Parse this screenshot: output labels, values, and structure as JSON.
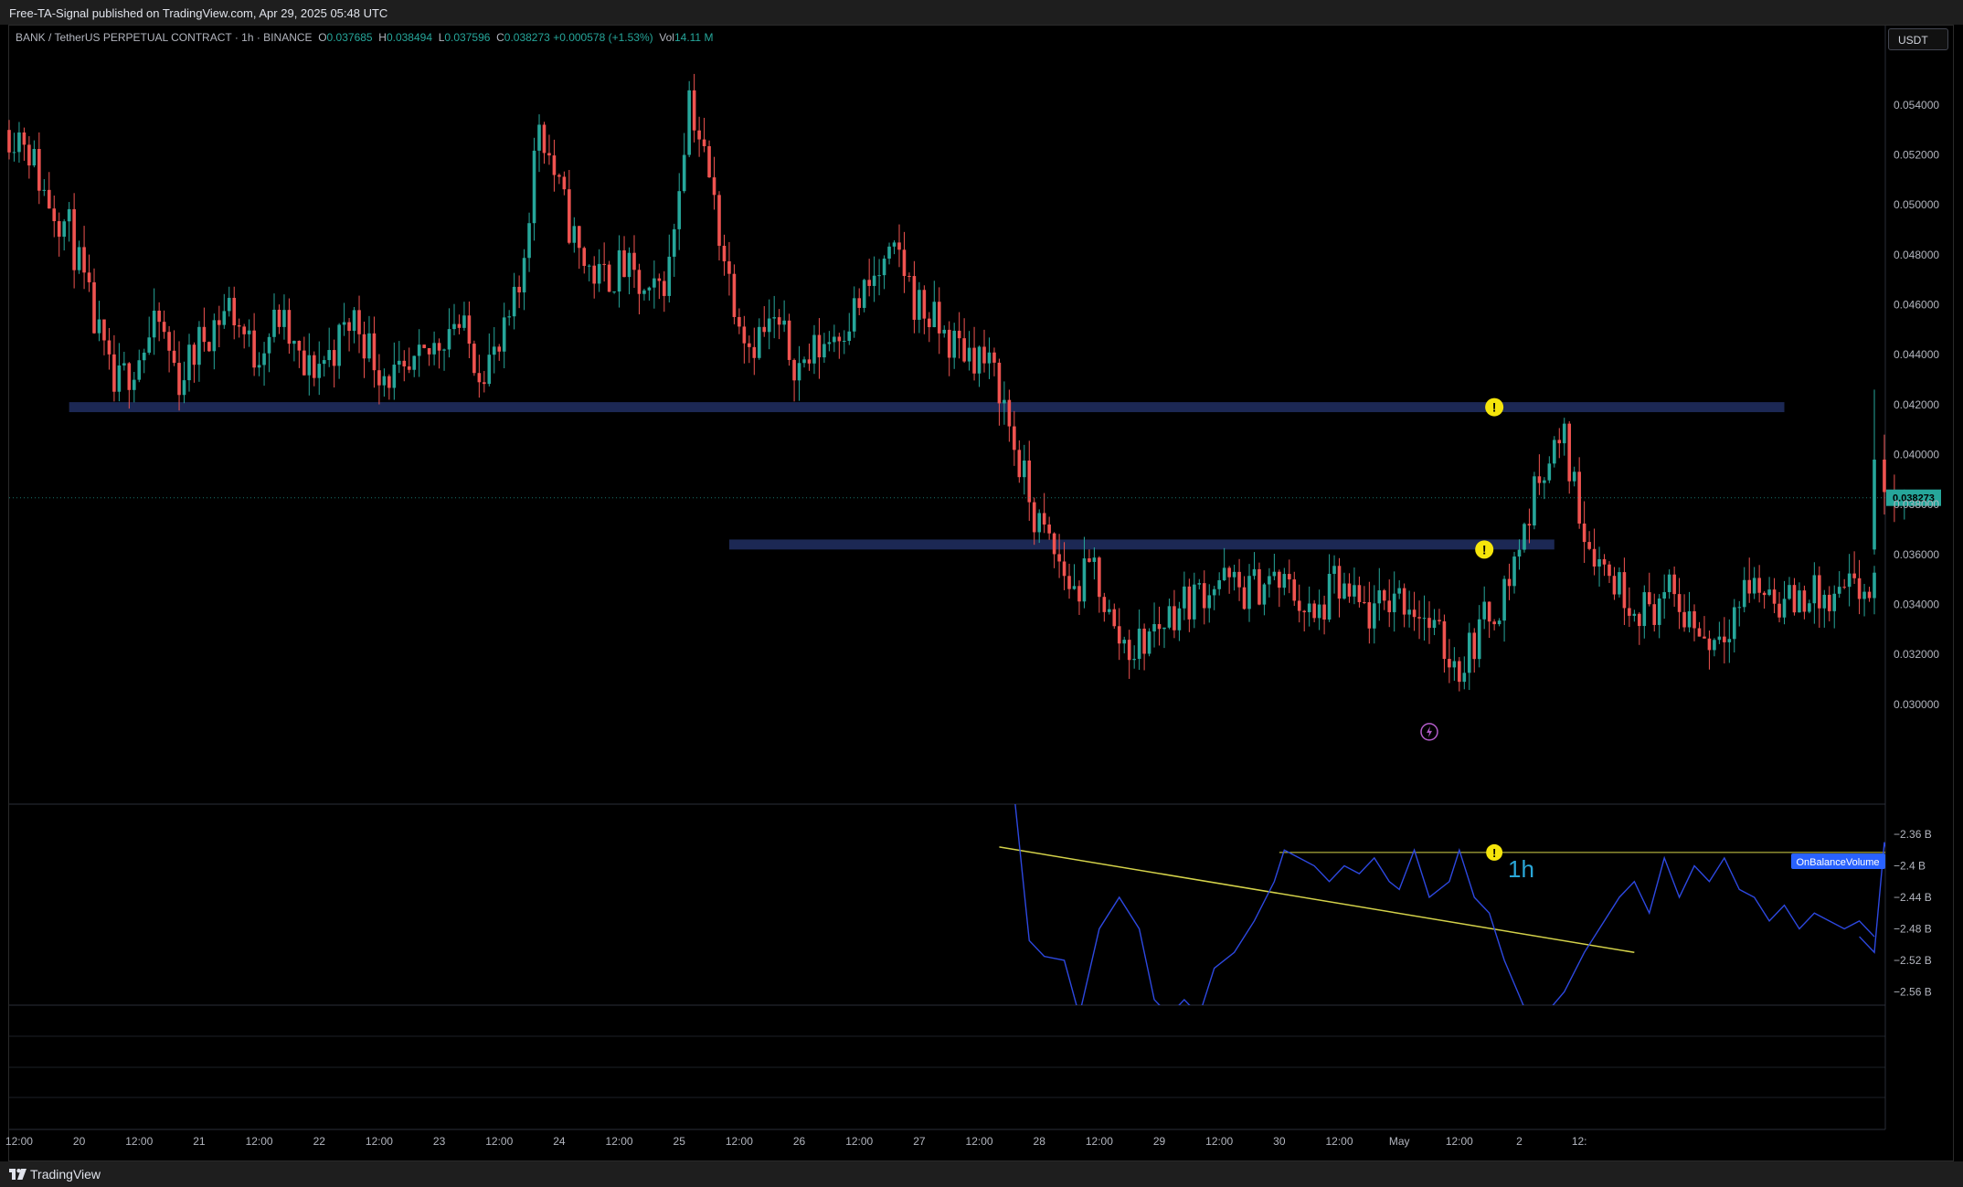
{
  "header": {
    "published": "Free-TA-Signal published on TradingView.com, Apr 29, 2025 05:48 UTC"
  },
  "footer": {
    "brand": "TradingView"
  },
  "legend": {
    "symbol": "BANK / TetherUS PERPETUAL CONTRACT · 1h · BINANCE",
    "o_label": "O",
    "o": "0.037685",
    "h_label": "H",
    "h": "0.038494",
    "l_label": "L",
    "l": "0.037596",
    "c_label": "C",
    "c": "0.038273",
    "change": "+0.000578 (+1.53%)",
    "vol_label": "Vol",
    "vol": "14.11 M"
  },
  "currency_button": "USDT",
  "colors": {
    "up": "#26a69a",
    "down": "#ef5350",
    "zone": "#1c2854",
    "obv": "#2d48e0",
    "trendline": "#d4d24a",
    "marker": "#f5e50b",
    "label_bg": "#2962ff",
    "price_tag": "#26a69a"
  },
  "chart_data": [
    {
      "type": "candlestick",
      "title": "BANK / TetherUS PERPETUAL CONTRACT · 1h · BINANCE",
      "timeframe": "1h",
      "x_ticks": [
        "12:00",
        "20",
        "12:00",
        "21",
        "12:00",
        "22",
        "12:00",
        "23",
        "12:00",
        "24",
        "12:00",
        "25",
        "12:00",
        "26",
        "12:00",
        "27",
        "12:00",
        "28",
        "12:00",
        "29",
        "12:00",
        "30",
        "12:00",
        "May",
        "12:00",
        "2",
        "12:"
      ],
      "x_range_hours": [
        -26,
        347
      ],
      "y_ticks": [
        "0.054000",
        "0.052000",
        "0.050000",
        "0.048000",
        "0.046000",
        "0.044000",
        "0.042000",
        "0.040000",
        "0.038000",
        "0.036000",
        "0.034000",
        "0.032000",
        "0.030000"
      ],
      "ylim": [
        0.0282,
        0.0563
      ],
      "last_price": "0.038273",
      "zones": [
        {
          "from_h": -14,
          "to_h": 329,
          "low": 0.0417,
          "high": 0.0421
        },
        {
          "from_h": 118,
          "to_h": 283,
          "low": 0.0362,
          "high": 0.0366
        }
      ],
      "alert_markers": [
        {
          "h": 271,
          "price": 0.0419
        },
        {
          "h": 269,
          "price": 0.0362
        }
      ],
      "lightning_marker": {
        "h": 258,
        "price": 0.0289
      },
      "pivots": [
        [
          -26,
          0.053
        ],
        [
          -23,
          0.0528
        ],
        [
          -19,
          0.0505
        ],
        [
          -14,
          0.049
        ],
        [
          -10,
          0.046
        ],
        [
          -5,
          0.0425
        ],
        [
          0,
          0.044
        ],
        [
          4,
          0.0452
        ],
        [
          8,
          0.043
        ],
        [
          13,
          0.0448
        ],
        [
          18,
          0.046
        ],
        [
          23,
          0.044
        ],
        [
          28,
          0.0455
        ],
        [
          33,
          0.0432
        ],
        [
          38,
          0.044
        ],
        [
          43,
          0.0455
        ],
        [
          48,
          0.0435
        ],
        [
          53,
          0.0428
        ],
        [
          58,
          0.044
        ],
        [
          63,
          0.0455
        ],
        [
          68,
          0.0436
        ],
        [
          72,
          0.044
        ],
        [
          76,
          0.0465
        ],
        [
          80,
          0.0535
        ],
        [
          84,
          0.0505
        ],
        [
          88,
          0.048
        ],
        [
          92,
          0.047
        ],
        [
          97,
          0.0475
        ],
        [
          102,
          0.046
        ],
        [
          106,
          0.0475
        ],
        [
          110,
          0.0545
        ],
        [
          114,
          0.051
        ],
        [
          118,
          0.047
        ],
        [
          122,
          0.0445
        ],
        [
          127,
          0.0452
        ],
        [
          132,
          0.0435
        ],
        [
          137,
          0.0445
        ],
        [
          142,
          0.0455
        ],
        [
          147,
          0.047
        ],
        [
          152,
          0.048
        ],
        [
          155,
          0.0462
        ],
        [
          158,
          0.0455
        ],
        [
          162,
          0.0445
        ],
        [
          168,
          0.044
        ],
        [
          172,
          0.0428
        ],
        [
          175,
          0.0403
        ],
        [
          179,
          0.0375
        ],
        [
          183,
          0.036
        ],
        [
          187,
          0.0345
        ],
        [
          191,
          0.0355
        ],
        [
          195,
          0.0328
        ],
        [
          199,
          0.0322
        ],
        [
          203,
          0.033
        ],
        [
          207,
          0.0338
        ],
        [
          212,
          0.0345
        ],
        [
          216,
          0.035
        ],
        [
          221,
          0.0345
        ],
        [
          226,
          0.035
        ],
        [
          231,
          0.0345
        ],
        [
          235,
          0.0332
        ],
        [
          239,
          0.0348
        ],
        [
          243,
          0.034
        ],
        [
          247,
          0.0335
        ],
        [
          251,
          0.0345
        ],
        [
          256,
          0.0338
        ],
        [
          260,
          0.0325
        ],
        [
          264,
          0.0315
        ],
        [
          268,
          0.033
        ],
        [
          273,
          0.0345
        ],
        [
          277,
          0.037
        ],
        [
          281,
          0.0398
        ],
        [
          285,
          0.0405
        ],
        [
          289,
          0.037
        ],
        [
          293,
          0.0355
        ],
        [
          297,
          0.0345
        ],
        [
          301,
          0.0338
        ],
        [
          306,
          0.0343
        ],
        [
          310,
          0.0335
        ],
        [
          314,
          0.0325
        ],
        [
          318,
          0.0335
        ],
        [
          322,
          0.0348
        ],
        [
          326,
          0.0345
        ],
        [
          330,
          0.034
        ],
        [
          334,
          0.0345
        ],
        [
          338,
          0.0338
        ],
        [
          342,
          0.0345
        ],
        [
          347,
          0.0345
        ]
      ]
    },
    {
      "type": "line",
      "timeframe_label": "1h",
      "series": [
        {
          "name": "OnBalanceVolume"
        }
      ],
      "y_ticks": [
        "−2.36 B",
        "−2.4 B",
        "−2.44 B",
        "−2.48 B",
        "−2.52 B",
        "−2.56 B"
      ],
      "ylim": [
        -2.577,
        -2.31
      ],
      "obv_points": [
        [
          175,
          -2.31
        ],
        [
          178,
          -2.495
        ],
        [
          181,
          -2.515
        ],
        [
          185,
          -2.52
        ],
        [
          188,
          -2.59
        ],
        [
          192,
          -2.48
        ],
        [
          196,
          -2.44
        ],
        [
          200,
          -2.48
        ],
        [
          203,
          -2.57
        ],
        [
          206,
          -2.59
        ],
        [
          209,
          -2.57
        ],
        [
          212,
          -2.59
        ],
        [
          215,
          -2.53
        ],
        [
          219,
          -2.51
        ],
        [
          223,
          -2.47
        ],
        [
          227,
          -2.42
        ],
        [
          229,
          -2.38
        ],
        [
          232,
          -2.39
        ],
        [
          235,
          -2.4
        ],
        [
          238,
          -2.42
        ],
        [
          241,
          -2.4
        ],
        [
          244,
          -2.41
        ],
        [
          247,
          -2.39
        ],
        [
          250,
          -2.42
        ],
        [
          252,
          -2.43
        ],
        [
          255,
          -2.38
        ],
        [
          258,
          -2.44
        ],
        [
          262,
          -2.42
        ],
        [
          264,
          -2.38
        ],
        [
          267,
          -2.44
        ],
        [
          270,
          -2.46
        ],
        [
          273,
          -2.52
        ],
        [
          277,
          -2.58
        ],
        [
          281,
          -2.59
        ],
        [
          285,
          -2.56
        ],
        [
          289,
          -2.51
        ],
        [
          293,
          -2.47
        ],
        [
          296,
          -2.44
        ],
        [
          299,
          -2.42
        ],
        [
          302,
          -2.46
        ],
        [
          305,
          -2.39
        ],
        [
          308,
          -2.44
        ],
        [
          311,
          -2.4
        ],
        [
          314,
          -2.42
        ],
        [
          317,
          -2.39
        ],
        [
          320,
          -2.43
        ],
        [
          323,
          -2.44
        ],
        [
          326,
          -2.47
        ],
        [
          329,
          -2.45
        ],
        [
          332,
          -2.48
        ],
        [
          335,
          -2.46
        ],
        [
          338,
          -2.47
        ],
        [
          341,
          -2.48
        ],
        [
          344,
          -2.47
        ],
        [
          347,
          -2.49
        ]
      ],
      "resistance_level": -2.383,
      "trendline": [
        [
          172,
          -2.376
        ],
        [
          299,
          -2.51
        ]
      ]
    }
  ]
}
